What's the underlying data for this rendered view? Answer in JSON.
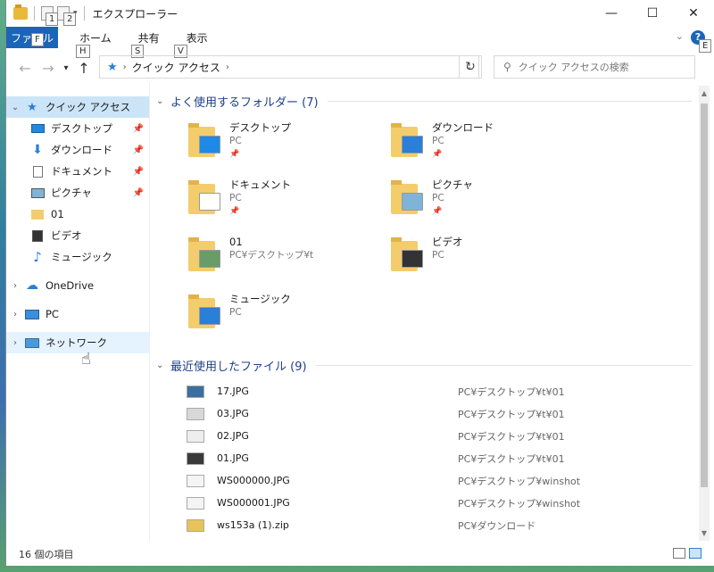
{
  "window": {
    "title": "エクスプローラー",
    "minimize": "—",
    "maximize": "☐",
    "close": "✕"
  },
  "keytips": {
    "qat1": "1",
    "qat2": "2",
    "file": "F",
    "home": "H",
    "share": "S",
    "view": "V",
    "help": "E"
  },
  "ribbon": {
    "file_label": "ファイル",
    "tabs": [
      "ホーム",
      "共有",
      "表示"
    ],
    "help": "?"
  },
  "nav": {
    "back": "←",
    "forward": "→",
    "up": "↑",
    "breadcrumb": "クイック アクセス",
    "refresh": "↻",
    "search_placeholder": "クイック アクセスの検索"
  },
  "sidebar": {
    "quick_access": "クイック アクセス",
    "items": [
      {
        "label": "デスクトップ",
        "icon": "desktop-icon",
        "pinned": true
      },
      {
        "label": "ダウンロード",
        "icon": "download-icon",
        "pinned": true
      },
      {
        "label": "ドキュメント",
        "icon": "document-icon",
        "pinned": true
      },
      {
        "label": "ピクチャ",
        "icon": "picture-icon",
        "pinned": true
      },
      {
        "label": "01",
        "icon": "folder-icon",
        "pinned": false
      },
      {
        "label": "ビデオ",
        "icon": "video-icon",
        "pinned": false
      },
      {
        "label": "ミュージック",
        "icon": "music-icon",
        "pinned": false
      }
    ],
    "onedrive": "OneDrive",
    "pc": "PC",
    "network": "ネットワーク"
  },
  "frequent": {
    "header": "よく使用するフォルダー (7)",
    "folders": [
      {
        "name": "デスクトップ",
        "location": "PC",
        "pinned": true,
        "overlay": "#1e8ae6"
      },
      {
        "name": "ダウンロード",
        "location": "PC",
        "pinned": true,
        "overlay": "#2a7fd6"
      },
      {
        "name": "ドキュメント",
        "location": "PC",
        "pinned": true,
        "overlay": "#ffffff"
      },
      {
        "name": "ピクチャ",
        "location": "PC",
        "pinned": true,
        "overlay": "#7fb4d8"
      },
      {
        "name": "01",
        "location": "PC¥デスクトップ¥t",
        "pinned": false,
        "overlay": "#6a9c6a"
      },
      {
        "name": "ビデオ",
        "location": "PC",
        "pinned": false,
        "overlay": "#333333"
      },
      {
        "name": "ミュージック",
        "location": "PC",
        "pinned": false,
        "overlay": "#2a7fd6"
      }
    ]
  },
  "recent": {
    "header": "最近使用したファイル (9)",
    "files": [
      {
        "name": "17.JPG",
        "location": "PC¥デスクトップ¥t¥01",
        "thumb": "#3b6fa0"
      },
      {
        "name": "03.JPG",
        "location": "PC¥デスクトップ¥t¥01",
        "thumb": "#d8d8d8"
      },
      {
        "name": "02.JPG",
        "location": "PC¥デスクトップ¥t¥01",
        "thumb": "#eeeeee"
      },
      {
        "name": "01.JPG",
        "location": "PC¥デスクトップ¥t¥01",
        "thumb": "#3a3a3a"
      },
      {
        "name": "WS000000.JPG",
        "location": "PC¥デスクトップ¥winshot",
        "thumb": "#f4f4f4"
      },
      {
        "name": "WS000001.JPG",
        "location": "PC¥デスクトップ¥winshot",
        "thumb": "#f4f4f4"
      },
      {
        "name": "ws153a (1).zip",
        "location": "PC¥ダウンロード",
        "thumb": "#e8c35a"
      }
    ]
  },
  "status": {
    "items": "16 個の項目"
  }
}
